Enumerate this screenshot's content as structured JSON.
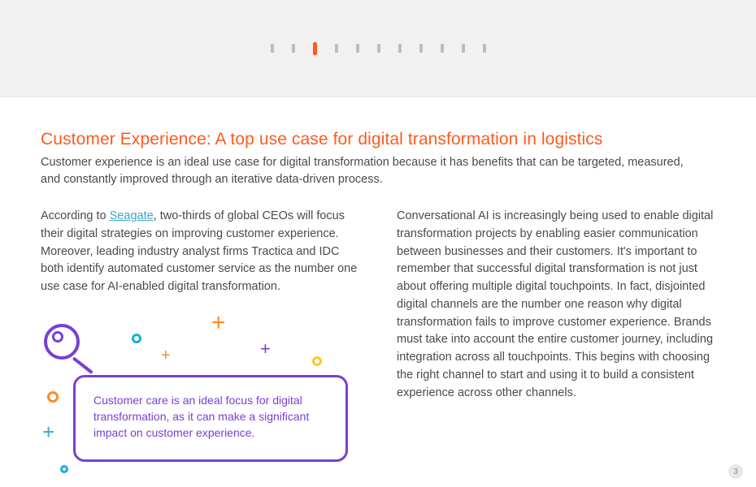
{
  "pager": {
    "total": 11,
    "active_index": 2
  },
  "title": "Customer Experience: A top use case for digital transformation in logistics",
  "intro": "Customer experience is an ideal use case for digital transformation because it has benefits that can be targeted, measured, and constantly improved through an iterative data-driven process.",
  "col1": {
    "pre": "According to ",
    "link_text": "Seagate",
    "post": ", two-thirds of global CEOs will focus their digital strategies on improving customer experience. Moreover, leading industry analyst firms Tractica and IDC both identify automated customer service as the number one use case for AI-enabled digital transformation."
  },
  "col2": {
    "body": "Conversational AI is increasingly being used to enable digital transformation projects by enabling easier communication between businesses and their customers. It's important to remember that successful digital transformation is not just about offering multiple digital touchpoints. In fact, disjointed digital channels are the number one reason why digital transformation fails to improve customer experience. Brands must take into account the entire customer journey, including integration across all touchpoints. This begins with choosing the right channel to start and using it to build a consistent experience across other channels."
  },
  "callout": "Customer care is an ideal focus for digital transformation, as it can make a significant impact on customer experience.",
  "page_number": "3"
}
